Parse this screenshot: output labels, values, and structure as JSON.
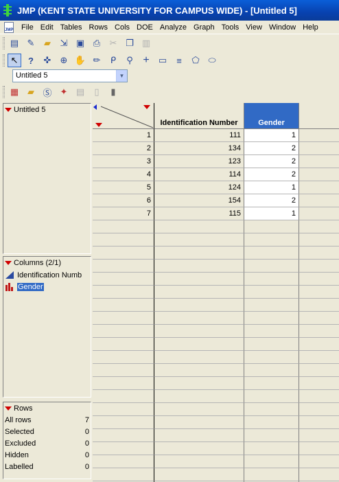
{
  "window": {
    "title": "JMP (KENT STATE UNIVERSITY FOR CAMPUS WIDE)  - [Untitled 5]"
  },
  "menubar": {
    "app_icon_text": "JMP",
    "items": [
      "File",
      "Edit",
      "Tables",
      "Rows",
      "Cols",
      "DOE",
      "Analyze",
      "Graph",
      "Tools",
      "View",
      "Window",
      "Help"
    ]
  },
  "toolbar_standard": [
    "new-table-icon",
    "new-script-icon",
    "open-icon",
    "import-icon",
    "save-icon",
    "print-icon",
    "cut-icon",
    "copy-icon",
    "paste-icon"
  ],
  "toolbar_tools": [
    "arrow-tool-icon",
    "help-tool-icon",
    "crosshair-tool-icon",
    "scroller-tool-icon",
    "grabber-tool-icon",
    "brush-tool-icon",
    "lasso-tool-icon",
    "magnifier-tool-icon",
    "crosshairs-tool-icon",
    "annotate-tool-icon",
    "line-tool-icon",
    "polygon-tool-icon",
    "ellipse-tool-icon"
  ],
  "table_selector": {
    "value": "Untitled 5"
  },
  "toolbar_tables": [
    "data-table-icon",
    "journal-icon",
    "script-icon",
    "jmp-starter-icon",
    "report-icon",
    "doc-icon",
    "window-list-icon"
  ],
  "table_panel": {
    "title": "Untitled 5"
  },
  "columns_panel": {
    "title": "Columns (2/1)",
    "items": [
      {
        "label": "Identification Numb",
        "icon": "continuous-icon"
      },
      {
        "label": "Gender",
        "icon": "nominal-icon"
      }
    ]
  },
  "rows_panel": {
    "title": "Rows",
    "stats": [
      {
        "label": "All rows",
        "value": "7"
      },
      {
        "label": "Selected",
        "value": "0"
      },
      {
        "label": "Excluded",
        "value": "0"
      },
      {
        "label": "Hidden",
        "value": "0"
      },
      {
        "label": "Labelled",
        "value": "0"
      }
    ]
  },
  "grid": {
    "columns": [
      "Identification Number",
      "Gender"
    ],
    "rows": [
      {
        "n": "1",
        "id": "111",
        "gender": "1"
      },
      {
        "n": "2",
        "id": "134",
        "gender": "2"
      },
      {
        "n": "3",
        "id": "123",
        "gender": "2"
      },
      {
        "n": "4",
        "id": "114",
        "gender": "2"
      },
      {
        "n": "5",
        "id": "124",
        "gender": "1"
      },
      {
        "n": "6",
        "id": "154",
        "gender": "2"
      },
      {
        "n": "7",
        "id": "115",
        "gender": "1"
      }
    ]
  },
  "colors": {
    "title_bar": "#0842b0",
    "selection": "#316ac5",
    "red_triangle": "#d00000"
  }
}
